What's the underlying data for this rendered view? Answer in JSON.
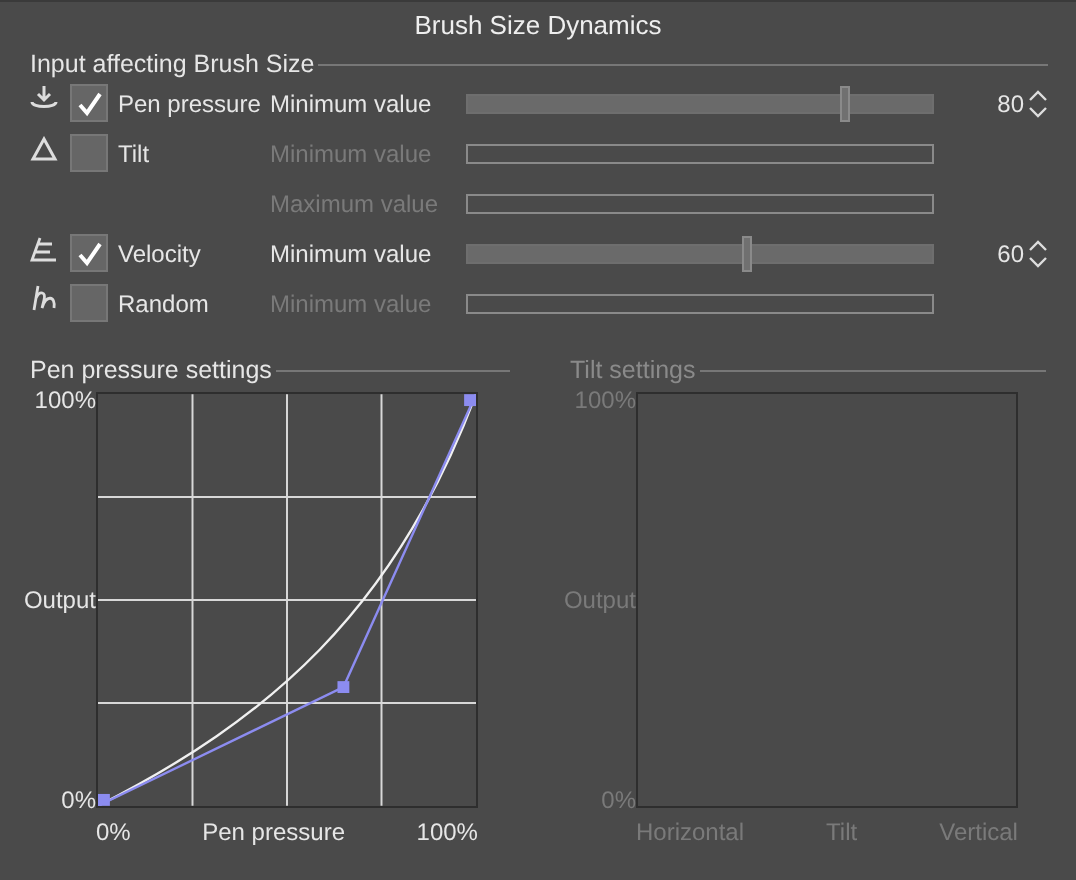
{
  "window": {
    "title": "Brush Size Dynamics"
  },
  "input_group": {
    "title": "Input affecting Brush Size",
    "inputs": [
      {
        "label": "Pen pressure",
        "checked": true,
        "sliders": [
          {
            "label": "Minimum value",
            "level": 0.81,
            "reading": "80"
          }
        ]
      },
      {
        "label": "Tilt",
        "checked": false,
        "sliders": [
          {
            "label": "Minimum value"
          },
          {
            "label": "Maximum value"
          }
        ]
      },
      {
        "label": "Velocity",
        "checked": true,
        "sliders": [
          {
            "label": "Minimum value",
            "level": 0.6,
            "reading": "60"
          }
        ]
      },
      {
        "label": "Random",
        "checked": false,
        "sliders": [
          {
            "label": "Minimum value"
          }
        ]
      }
    ]
  },
  "curves": [
    {
      "title": "Pen pressure settings",
      "disabled": false,
      "y_labels": [
        "100%",
        "Output",
        "0%"
      ],
      "x_labels": [
        "0%",
        "Pen pressure",
        "100%"
      ]
    },
    {
      "title": "Tilt settings",
      "disabled": true,
      "y_labels": [
        "100%",
        "Output",
        "0%"
      ],
      "x_labels": [
        "Horizontal",
        "Tilt",
        "Vertical"
      ]
    }
  ]
}
